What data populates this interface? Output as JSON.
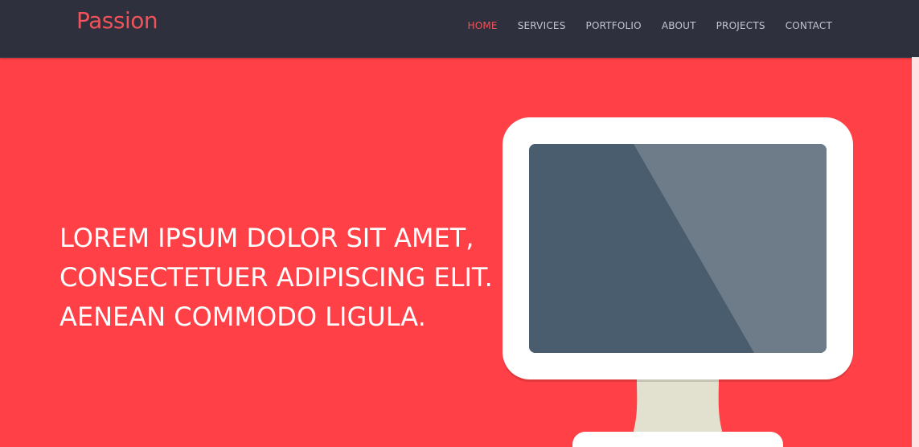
{
  "header": {
    "brand": "Passion",
    "nav": [
      {
        "label": "HOME",
        "active": true
      },
      {
        "label": "SERVICES",
        "active": false
      },
      {
        "label": "PORTFOLIO",
        "active": false
      },
      {
        "label": "ABOUT",
        "active": false
      },
      {
        "label": "PROJECTS",
        "active": false
      },
      {
        "label": "CONTACT",
        "active": false
      }
    ]
  },
  "hero": {
    "headline_lines": [
      "LOREM IPSUM DOLOR SIT AMET,",
      "CONSECTETUER ADIPISCING ELIT.",
      "AENEAN COMMODO LIGULA."
    ],
    "illustration": "monitor-illustration"
  },
  "colors": {
    "hero_bg": "#ff4046",
    "navbar_bg": "#2e313d",
    "accent": "#f0525a",
    "nav_text": "#c2c6cf",
    "screen_dark": "#4a5d6e",
    "screen_light": "#6d7c88",
    "stand": "#e2e0ce"
  }
}
